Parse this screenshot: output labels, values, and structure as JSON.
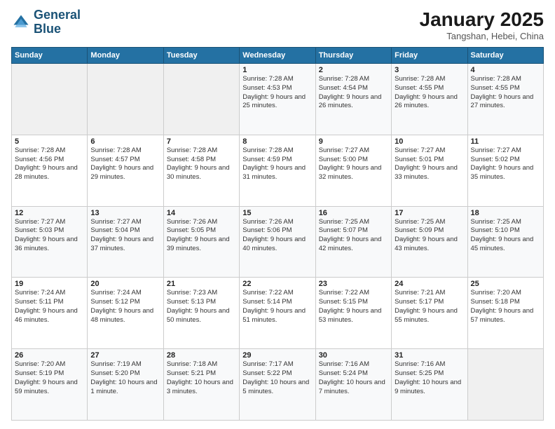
{
  "header": {
    "logo_line1": "General",
    "logo_line2": "Blue",
    "month": "January 2025",
    "location": "Tangshan, Hebei, China"
  },
  "weekdays": [
    "Sunday",
    "Monday",
    "Tuesday",
    "Wednesday",
    "Thursday",
    "Friday",
    "Saturday"
  ],
  "weeks": [
    [
      {
        "day": "",
        "sunrise": "",
        "sunset": "",
        "daylight": ""
      },
      {
        "day": "",
        "sunrise": "",
        "sunset": "",
        "daylight": ""
      },
      {
        "day": "",
        "sunrise": "",
        "sunset": "",
        "daylight": ""
      },
      {
        "day": "1",
        "sunrise": "Sunrise: 7:28 AM",
        "sunset": "Sunset: 4:53 PM",
        "daylight": "Daylight: 9 hours and 25 minutes."
      },
      {
        "day": "2",
        "sunrise": "Sunrise: 7:28 AM",
        "sunset": "Sunset: 4:54 PM",
        "daylight": "Daylight: 9 hours and 26 minutes."
      },
      {
        "day": "3",
        "sunrise": "Sunrise: 7:28 AM",
        "sunset": "Sunset: 4:55 PM",
        "daylight": "Daylight: 9 hours and 26 minutes."
      },
      {
        "day": "4",
        "sunrise": "Sunrise: 7:28 AM",
        "sunset": "Sunset: 4:55 PM",
        "daylight": "Daylight: 9 hours and 27 minutes."
      }
    ],
    [
      {
        "day": "5",
        "sunrise": "Sunrise: 7:28 AM",
        "sunset": "Sunset: 4:56 PM",
        "daylight": "Daylight: 9 hours and 28 minutes."
      },
      {
        "day": "6",
        "sunrise": "Sunrise: 7:28 AM",
        "sunset": "Sunset: 4:57 PM",
        "daylight": "Daylight: 9 hours and 29 minutes."
      },
      {
        "day": "7",
        "sunrise": "Sunrise: 7:28 AM",
        "sunset": "Sunset: 4:58 PM",
        "daylight": "Daylight: 9 hours and 30 minutes."
      },
      {
        "day": "8",
        "sunrise": "Sunrise: 7:28 AM",
        "sunset": "Sunset: 4:59 PM",
        "daylight": "Daylight: 9 hours and 31 minutes."
      },
      {
        "day": "9",
        "sunrise": "Sunrise: 7:27 AM",
        "sunset": "Sunset: 5:00 PM",
        "daylight": "Daylight: 9 hours and 32 minutes."
      },
      {
        "day": "10",
        "sunrise": "Sunrise: 7:27 AM",
        "sunset": "Sunset: 5:01 PM",
        "daylight": "Daylight: 9 hours and 33 minutes."
      },
      {
        "day": "11",
        "sunrise": "Sunrise: 7:27 AM",
        "sunset": "Sunset: 5:02 PM",
        "daylight": "Daylight: 9 hours and 35 minutes."
      }
    ],
    [
      {
        "day": "12",
        "sunrise": "Sunrise: 7:27 AM",
        "sunset": "Sunset: 5:03 PM",
        "daylight": "Daylight: 9 hours and 36 minutes."
      },
      {
        "day": "13",
        "sunrise": "Sunrise: 7:27 AM",
        "sunset": "Sunset: 5:04 PM",
        "daylight": "Daylight: 9 hours and 37 minutes."
      },
      {
        "day": "14",
        "sunrise": "Sunrise: 7:26 AM",
        "sunset": "Sunset: 5:05 PM",
        "daylight": "Daylight: 9 hours and 39 minutes."
      },
      {
        "day": "15",
        "sunrise": "Sunrise: 7:26 AM",
        "sunset": "Sunset: 5:06 PM",
        "daylight": "Daylight: 9 hours and 40 minutes."
      },
      {
        "day": "16",
        "sunrise": "Sunrise: 7:25 AM",
        "sunset": "Sunset: 5:07 PM",
        "daylight": "Daylight: 9 hours and 42 minutes."
      },
      {
        "day": "17",
        "sunrise": "Sunrise: 7:25 AM",
        "sunset": "Sunset: 5:09 PM",
        "daylight": "Daylight: 9 hours and 43 minutes."
      },
      {
        "day": "18",
        "sunrise": "Sunrise: 7:25 AM",
        "sunset": "Sunset: 5:10 PM",
        "daylight": "Daylight: 9 hours and 45 minutes."
      }
    ],
    [
      {
        "day": "19",
        "sunrise": "Sunrise: 7:24 AM",
        "sunset": "Sunset: 5:11 PM",
        "daylight": "Daylight: 9 hours and 46 minutes."
      },
      {
        "day": "20",
        "sunrise": "Sunrise: 7:24 AM",
        "sunset": "Sunset: 5:12 PM",
        "daylight": "Daylight: 9 hours and 48 minutes."
      },
      {
        "day": "21",
        "sunrise": "Sunrise: 7:23 AM",
        "sunset": "Sunset: 5:13 PM",
        "daylight": "Daylight: 9 hours and 50 minutes."
      },
      {
        "day": "22",
        "sunrise": "Sunrise: 7:22 AM",
        "sunset": "Sunset: 5:14 PM",
        "daylight": "Daylight: 9 hours and 51 minutes."
      },
      {
        "day": "23",
        "sunrise": "Sunrise: 7:22 AM",
        "sunset": "Sunset: 5:15 PM",
        "daylight": "Daylight: 9 hours and 53 minutes."
      },
      {
        "day": "24",
        "sunrise": "Sunrise: 7:21 AM",
        "sunset": "Sunset: 5:17 PM",
        "daylight": "Daylight: 9 hours and 55 minutes."
      },
      {
        "day": "25",
        "sunrise": "Sunrise: 7:20 AM",
        "sunset": "Sunset: 5:18 PM",
        "daylight": "Daylight: 9 hours and 57 minutes."
      }
    ],
    [
      {
        "day": "26",
        "sunrise": "Sunrise: 7:20 AM",
        "sunset": "Sunset: 5:19 PM",
        "daylight": "Daylight: 9 hours and 59 minutes."
      },
      {
        "day": "27",
        "sunrise": "Sunrise: 7:19 AM",
        "sunset": "Sunset: 5:20 PM",
        "daylight": "Daylight: 10 hours and 1 minute."
      },
      {
        "day": "28",
        "sunrise": "Sunrise: 7:18 AM",
        "sunset": "Sunset: 5:21 PM",
        "daylight": "Daylight: 10 hours and 3 minutes."
      },
      {
        "day": "29",
        "sunrise": "Sunrise: 7:17 AM",
        "sunset": "Sunset: 5:22 PM",
        "daylight": "Daylight: 10 hours and 5 minutes."
      },
      {
        "day": "30",
        "sunrise": "Sunrise: 7:16 AM",
        "sunset": "Sunset: 5:24 PM",
        "daylight": "Daylight: 10 hours and 7 minutes."
      },
      {
        "day": "31",
        "sunrise": "Sunrise: 7:16 AM",
        "sunset": "Sunset: 5:25 PM",
        "daylight": "Daylight: 10 hours and 9 minutes."
      },
      {
        "day": "",
        "sunrise": "",
        "sunset": "",
        "daylight": ""
      }
    ]
  ]
}
